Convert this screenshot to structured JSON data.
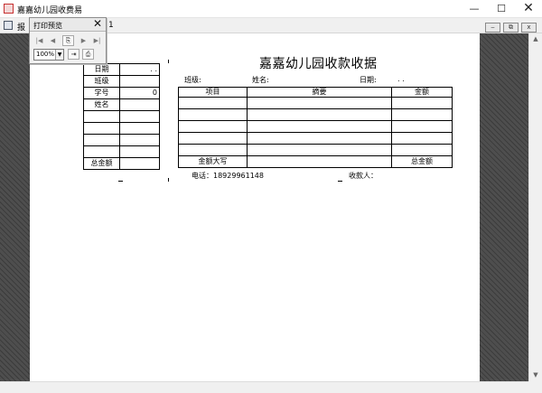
{
  "window": {
    "title": "嘉嘉幼儿园收费易",
    "minimize_glyph": "—",
    "maximize_glyph": "☐",
    "close_glyph": "✕",
    "app_icon": "app-icon"
  },
  "menubar": {
    "report_label": "报",
    "page_indicator": "1",
    "doc_icon": "report-document-icon",
    "mdi_minimize": "‒",
    "mdi_restore": "⧉",
    "mdi_close": "x"
  },
  "preview_toolbar": {
    "title": "打印预览",
    "close_glyph": "✕",
    "first_page": "|◀",
    "prev_page": "◀",
    "copy_icon": "⎘",
    "next_page": "▶",
    "last_page": "▶|",
    "zoom_value": "100%",
    "zoom_arrow": "▼",
    "export_icon": "⇥",
    "print_icon": "⎙"
  },
  "stub": {
    "rows": [
      {
        "label": "日期",
        "value": ".  ."
      },
      {
        "label": "班级",
        "value": ""
      },
      {
        "label": "学号",
        "value": "0"
      },
      {
        "label": "姓名",
        "value": ""
      },
      {
        "label": "",
        "value": ""
      },
      {
        "label": "",
        "value": ""
      },
      {
        "label": "",
        "value": ""
      },
      {
        "label": "",
        "value": ""
      },
      {
        "label": "总金额",
        "value": ""
      }
    ]
  },
  "receipt": {
    "title": "嘉嘉幼儿园收款收据",
    "class_label": "班级:",
    "name_label": "姓名:",
    "date_label": "日期:",
    "date_value": ".   .",
    "columns": [
      "项目",
      "摘要",
      "金额"
    ],
    "empty_rows": 5,
    "amount_words_label": "金额大写",
    "amount_words_value": "",
    "total_label": "总金额",
    "total_value": "",
    "phone_text": "电话：18929961148",
    "payee_label": "收款人："
  },
  "scrollbars": {
    "up_arrow": "▲",
    "down_arrow": "▼"
  }
}
